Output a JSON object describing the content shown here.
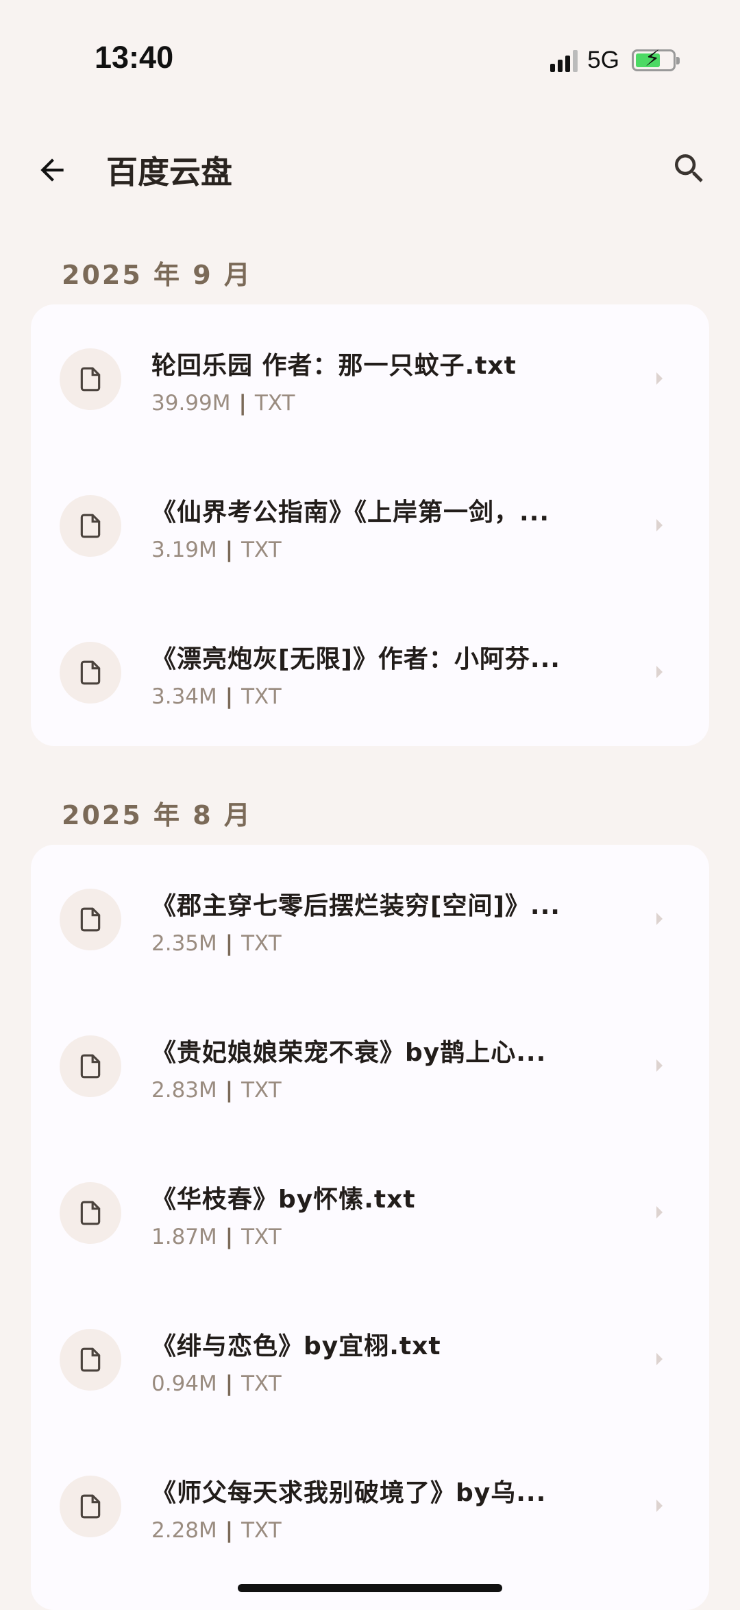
{
  "status_bar": {
    "time": "13:40",
    "network": "5G"
  },
  "header": {
    "title": "百度云盘",
    "back_icon": "arrow-left-icon",
    "search_icon": "search-icon"
  },
  "sections": [
    {
      "label": "2025 年 9 月",
      "files": [
        {
          "name": "轮回乐园  作者：那一只蚊子.txt",
          "size": "39.99M",
          "type": "TXT"
        },
        {
          "name": "《仙界考公指南》《上岸第一剑，...",
          "size": "3.19M",
          "type": "TXT"
        },
        {
          "name": "《漂亮炮灰[无限]》作者：小阿芬...",
          "size": "3.34M",
          "type": "TXT"
        }
      ]
    },
    {
      "label": "2025 年 8 月",
      "files": [
        {
          "name": "《郡主穿七零后摆烂装穷[空间]》...",
          "size": "2.35M",
          "type": "TXT"
        },
        {
          "name": "《贵妃娘娘荣宠不衰》by鹊上心...",
          "size": "2.83M",
          "type": "TXT"
        },
        {
          "name": "《华枝春》by怀愫.txt",
          "size": "1.87M",
          "type": "TXT"
        },
        {
          "name": "《绯与恋色》by宜栩.txt",
          "size": "0.94M",
          "type": "TXT"
        },
        {
          "name": "《师父每天求我别破境了》by乌...",
          "size": "2.28M",
          "type": "TXT"
        }
      ]
    }
  ],
  "colors": {
    "background": "#f8f3f1",
    "card": "#fdfbff",
    "section_header": "#7b6a58",
    "meta": "#9a8c80"
  }
}
